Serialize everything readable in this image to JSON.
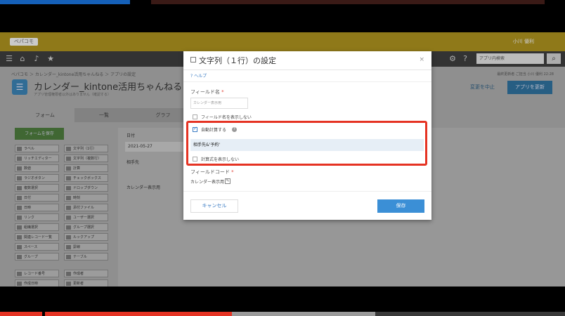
{
  "header": {
    "logo_text": "ベパコモ",
    "user_name": "小川 優利",
    "search_placeholder": "アプリ内検索"
  },
  "breadcrumb": "ベパコモ ＞ カレンダー_kintone活用ちゃんねる ＞ アプリの設定",
  "app": {
    "title": "カレンダー_kintone活用ちゃんねる",
    "subtitle": "アプリ管理権限者以外はありません（確認する）",
    "updated": "最終更新者 ご担当 小川 優利 22:28",
    "cancel_label": "変更を中止",
    "update_label": "アプリを更新"
  },
  "tabs": [
    "フォーム",
    "一覧",
    "グラフ"
  ],
  "palette": {
    "title": "フォームを保存",
    "items": [
      "ラベル",
      "文字列（1行）",
      "リッチエディター",
      "文字列（複数行）",
      "数値",
      "計算",
      "ラジオボタン",
      "チェックボックス",
      "複数選択",
      "ドロップダウン",
      "日付",
      "時刻",
      "日時",
      "添付ファイル",
      "リンク",
      "ユーザー選択",
      "組織選択",
      "グループ選択",
      "関連レコード一覧",
      "ルックアップ",
      "スペース",
      "罫線",
      "グループ",
      "テーブル",
      "レコード番号",
      "作成者",
      "作成日時",
      "更新者"
    ]
  },
  "form": {
    "date_label": "日付",
    "date_value": "2021-05-27",
    "partner_label": "相手先",
    "calendar_label": "カレンダー表示用"
  },
  "dialog": {
    "title": "文字列（１行）の設定",
    "close": "×",
    "help": "? ヘルプ",
    "field_name_label": "フィールド名",
    "required_mark": "*",
    "field_name_value": "カレンダー表示用",
    "hide_name_label": "フィールド名を表示しない",
    "auto_calc_label": "自動計算する",
    "formula_value": "相手先&'予約'",
    "hide_formula_label": "計算式を表示しない",
    "field_code_label": "フィールドコード",
    "field_code_value": "カレンダー表示用",
    "cancel_label": "キャンセル",
    "save_label": "保存"
  },
  "colors": {
    "highlight": "#e53323",
    "save_button": "#3b8fd6",
    "topbar": "#a98f1e"
  }
}
